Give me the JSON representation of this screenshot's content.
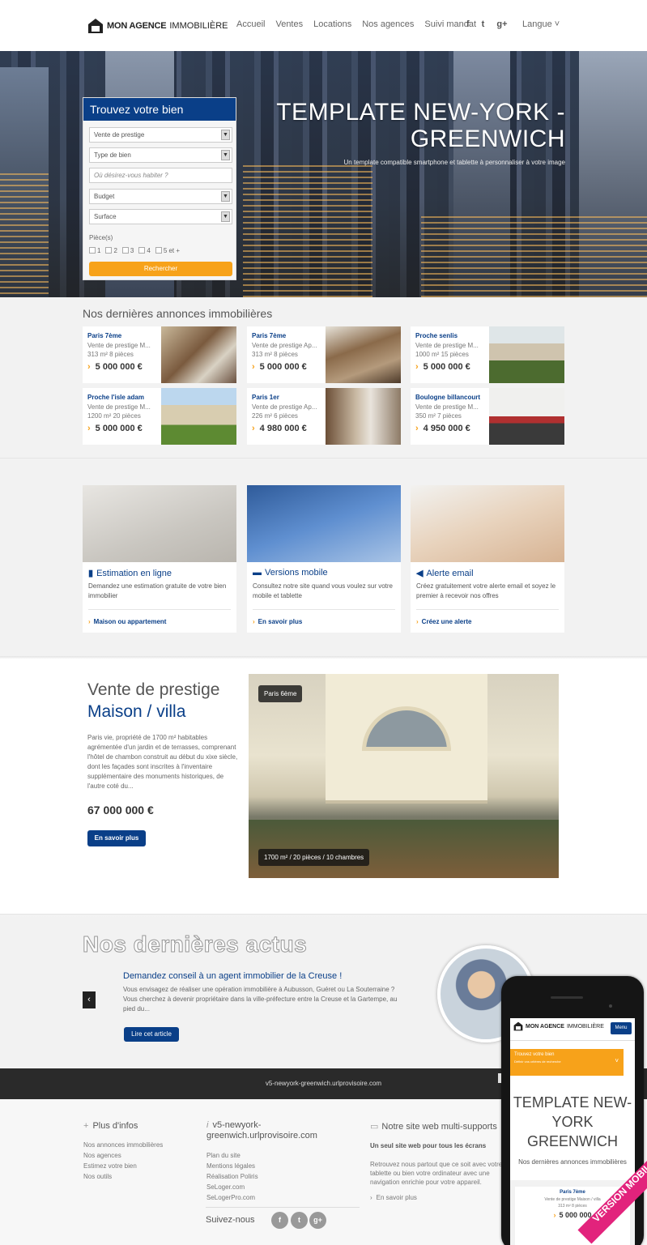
{
  "header": {
    "logo_bold": "MON AGENCE",
    "logo_light": "IMMOBILIÈRE",
    "nav": [
      "Accueil",
      "Ventes",
      "Locations",
      "Nos agences",
      "Suivi mandat"
    ],
    "social": [
      "f",
      "t",
      "g+"
    ],
    "language_label": "Langue ˅"
  },
  "hero": {
    "title": "TEMPLATE NEW-YORK - GREENWICH",
    "subtitle": "Un template compatible smartphone et tablette à personnaliser à votre image"
  },
  "search": {
    "title": "Trouvez votre bien",
    "fields": [
      "Vente de prestige",
      "Type de bien",
      "Où désirez-vous habiter ?",
      "Budget",
      "Surface"
    ],
    "pieces_label": "Pièce(s)",
    "pieces_options": [
      "1",
      "2",
      "3",
      "4",
      "5 et +"
    ],
    "button": "Rechercher"
  },
  "listings": {
    "title": "Nos dernières annonces immobilières",
    "items": [
      {
        "city": "Paris 7ème",
        "desc": "Vente de prestige M...",
        "size": "313 m² 8 pièces",
        "price": "5 000 000 €"
      },
      {
        "city": "Paris 7ème",
        "desc": "Vente de prestige Ap...",
        "size": "313 m² 8 pièces",
        "price": "5 000 000 €"
      },
      {
        "city": "Proche senlis",
        "desc": "Vente de prestige M...",
        "size": "1000 m² 15 pièces",
        "price": "5 000 000 €"
      },
      {
        "city": "Proche l'isle adam",
        "desc": "Vente de prestige M...",
        "size": "1200 m² 20 pièces",
        "price": "5 000 000 €"
      },
      {
        "city": "Paris 1er",
        "desc": "Vente de prestige Ap...",
        "size": "226 m² 6 pièces",
        "price": "4 980 000 €"
      },
      {
        "city": "Boulogne billancourt",
        "desc": "Vente de prestige M...",
        "size": "350 m² 7 pièces",
        "price": "4 950 000 €"
      }
    ]
  },
  "services": [
    {
      "title": "Estimation en ligne",
      "icon": "bar-chart-icon",
      "body": "Demandez une estimation gratuite de votre bien immobilier",
      "link": "Maison ou appartement"
    },
    {
      "title": "Versions mobile",
      "icon": "chat-icon",
      "body": "Consultez notre site quand vous voulez sur votre mobile et tablette",
      "link": "En savoir plus"
    },
    {
      "title": "Alerte email",
      "icon": "megaphone-icon",
      "body": "Créez gratuitement votre alerte email et soyez le premier à recevoir nos offres",
      "link": "Créez une alerte"
    }
  ],
  "featured": {
    "title_1": "Vente de prestige",
    "title_2": "Maison / villa",
    "description": "Paris vie, propriété de 1700 m² habitables agrémentée d'un jardin et de terrasses, comprenant l'hôtel de chambon construit au début du xixe siècle, dont les façades sont inscrites à l'inventaire supplémentaire des monuments historiques, de l'autre coté du...",
    "price": "67 000 000 €",
    "button": "En savoir plus",
    "location_tag": "Paris 6ème",
    "details_tag": "1700 m² / 20 pièces / 10 chambres"
  },
  "news": {
    "title": "Nos dernières actus",
    "headline": "Demandez conseil à un agent immobilier de la Creuse !",
    "body": "Vous envisagez de réaliser une opération immobilière à Aubusson, Guéret ou La Souterraine ? Vous cherchez à devenir propriétaire dans la ville-préfecture entre la Creuse et la Gartempe, au pied du...",
    "button": "Lire cet article"
  },
  "footer": {
    "bar_url": "v5-newyork-greenwich.urlprovisoire.com",
    "col1": {
      "title": "Plus d'infos",
      "items": [
        "Nos annonces immobilières",
        "Nos agences",
        "Estimez votre bien",
        "Nos outils"
      ]
    },
    "col2": {
      "title": "v5-newyork-greenwich.urlprovisoire.com",
      "items": [
        "Plan du site",
        "Mentions légales",
        "Réalisation Poliris",
        "SeLoger.com",
        "SeLogerPro.com"
      ]
    },
    "col3": {
      "title": "Notre site web multi-supports",
      "subtitle": "Un seul site web pour tous les écrans",
      "body": "Retrouvez nous partout que ce soit avec votre tablette ou bien votre ordinateur avec une navigation enrichie pour votre appareil.",
      "link": "En savoir plus"
    },
    "follow_label": "Suivez-nous",
    "follow_icons": [
      "f",
      "t",
      "g+"
    ]
  },
  "phone": {
    "logo_bold": "MON AGENCE",
    "logo_light": "IMMOBILIÈRE",
    "menu": "Menu",
    "search_title": "Trouvez votre bien",
    "search_sub": "Définir vos critères de recherche",
    "title": "TEMPLATE NEW-YORK GREENWICH",
    "listings_title": "Nos dernières annonces immobilières",
    "card_city": "Paris 7ème",
    "card_desc": "Vente de prestige Maison / villa",
    "card_size": "313 m² 8 pièces",
    "card_price": "5 000 000",
    "ribbon": "VERSION MOBILE"
  },
  "colors": {
    "brand_blue": "#0a3f88",
    "accent_orange": "#f7a21a",
    "ribbon_pink": "#e2237c"
  }
}
